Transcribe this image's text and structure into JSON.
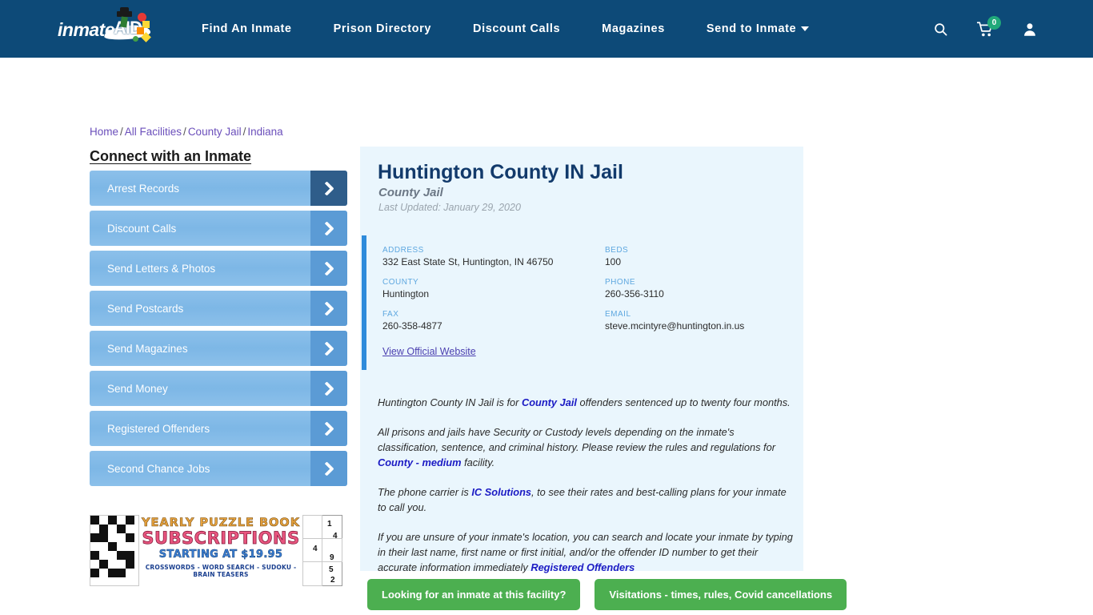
{
  "header": {
    "logo": {
      "text": "inmate",
      "aid": "AID"
    },
    "nav": [
      {
        "label": "Find An Inmate",
        "has_caret": false
      },
      {
        "label": "Prison Directory",
        "has_caret": false
      },
      {
        "label": "Discount Calls",
        "has_caret": false
      },
      {
        "label": "Magazines",
        "has_caret": false
      },
      {
        "label": "Send to Inmate",
        "has_caret": true
      }
    ],
    "icons": {
      "search": "search-icon",
      "cart": "cart-icon",
      "cart_badge": "0",
      "account": "user-icon"
    },
    "colors": {
      "bar": "#0d4a78",
      "badge": "#20a97a"
    }
  },
  "breadcrumb": {
    "items": [
      "Home",
      "All Facilities",
      "County Jail",
      "Indiana"
    ],
    "separator": "/"
  },
  "sidebar": {
    "title": "Connect with an Inmate",
    "items": [
      {
        "label": "Arrest Records",
        "active": true
      },
      {
        "label": "Discount Calls",
        "active": false
      },
      {
        "label": "Send Letters & Photos",
        "active": false
      },
      {
        "label": "Send Postcards",
        "active": false
      },
      {
        "label": "Send Magazines",
        "active": false
      },
      {
        "label": "Send Money",
        "active": false
      },
      {
        "label": "Registered Offenders",
        "active": false
      },
      {
        "label": "Second Chance Jobs",
        "active": false
      }
    ]
  },
  "ad": {
    "line1": "YEARLY PUZZLE BOOK",
    "line2": "SUBSCRIPTIONS",
    "line3": "STARTING AT $19.95",
    "line4": "CROSSWORDS - WORD SEARCH - SUDOKU - BRAIN TEASERS",
    "sudoku_digits": [
      "1",
      "4",
      "4",
      "9",
      "5",
      "2"
    ]
  },
  "facility": {
    "name": "Huntington County IN Jail",
    "type": "County Jail",
    "last_updated": "Last Updated: January 29, 2020",
    "fields": {
      "address_label": "ADDRESS",
      "address_value": "332 East State St, Huntington, IN 46750",
      "county_label": "COUNTY",
      "county_value": "Huntington",
      "fax_label": "FAX",
      "fax_value": "260-358-4877",
      "beds_label": "BEDS",
      "beds_value": "100",
      "phone_label": "PHONE",
      "phone_value": "260-356-3110",
      "email_label": "EMAIL",
      "email_value": "steve.mcintyre@huntington.in.us"
    },
    "official_website_link": "View Official Website"
  },
  "description": {
    "p1_a": "Huntington County IN Jail is for ",
    "p1_link": "County Jail",
    "p1_b": " offenders sentenced up to twenty four months.",
    "p2_a": "All prisons and jails have Security or Custody levels depending on the inmate's classification, sentence, and criminal history. Please review the rules and regulations for ",
    "p2_link": "County - medium",
    "p2_b": " facility.",
    "p3_a": "The phone carrier is ",
    "p3_link": "IC Solutions",
    "p3_b": ", to see their rates and best-calling plans for your inmate to call you.",
    "p4_a": "If you are unsure of your inmate's location, you can search and locate your inmate by typing in their last name, first name or first initial, and/or the offender ID number to get their accurate information immediately ",
    "p4_link": "Registered Offenders",
    "p4_b": ""
  },
  "cta": {
    "buttons": [
      "Looking for an inmate at this facility?",
      "Visitations - times, rules, Covid cancellations"
    ],
    "color": "#4caf50"
  }
}
